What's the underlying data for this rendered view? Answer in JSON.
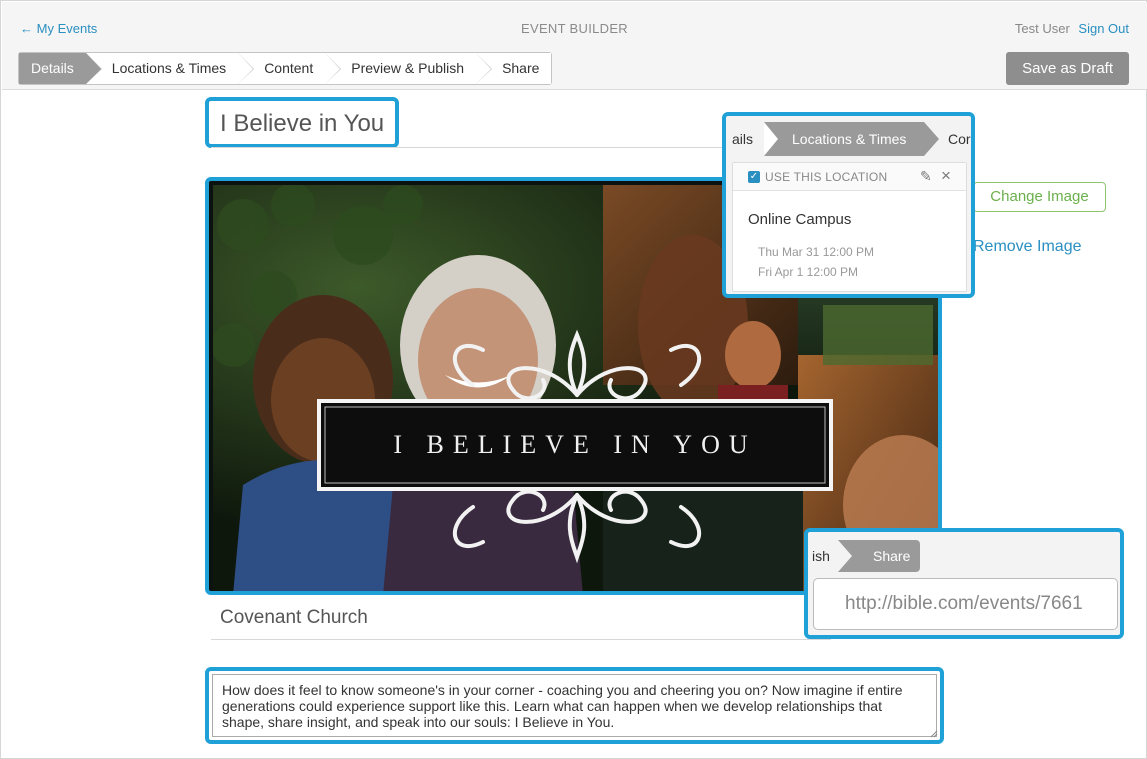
{
  "header": {
    "back_arrow": "←",
    "back_link": "My Events",
    "title": "EVENT BUILDER",
    "user_name": "Test User",
    "sign_out": "Sign Out"
  },
  "steps": [
    {
      "label": "Details",
      "active": true
    },
    {
      "label": "Locations & Times",
      "active": false
    },
    {
      "label": "Content",
      "active": false
    },
    {
      "label": "Preview & Publish",
      "active": false
    },
    {
      "label": "Share",
      "active": false
    }
  ],
  "save_draft": "Save as Draft",
  "event": {
    "title": "I Believe in You",
    "image_caption": "I BELIEVE IN YOU",
    "change_image": "Change Image",
    "remove_image": "Remove Image",
    "church": "Covenant Church",
    "description": "How does it feel to know someone's in your corner - coaching you and cheering you on? Now imagine if entire generations could experience support like this. Learn what can happen when we develop relationships that shape, share insight, and speak into our souls: I Believe in You."
  },
  "location_callout": {
    "tab_prev": "ails",
    "tab_active": "Locations & Times",
    "tab_next": "Cor",
    "use_location": "USE THIS LOCATION",
    "use_location_checked": true,
    "location_name": "Online Campus",
    "times": [
      "Thu Mar 31 12:00 PM",
      "Fri Apr 1 12:00 PM"
    ]
  },
  "share_callout": {
    "tab_prev": "ish",
    "tab_active": "Share",
    "url": "http://bible.com/events/7661"
  },
  "colors": {
    "highlight": "#1fa0d6",
    "link": "#2a8fc1",
    "active_step": "#9a9a9a",
    "change_image": "#6ab04c"
  }
}
